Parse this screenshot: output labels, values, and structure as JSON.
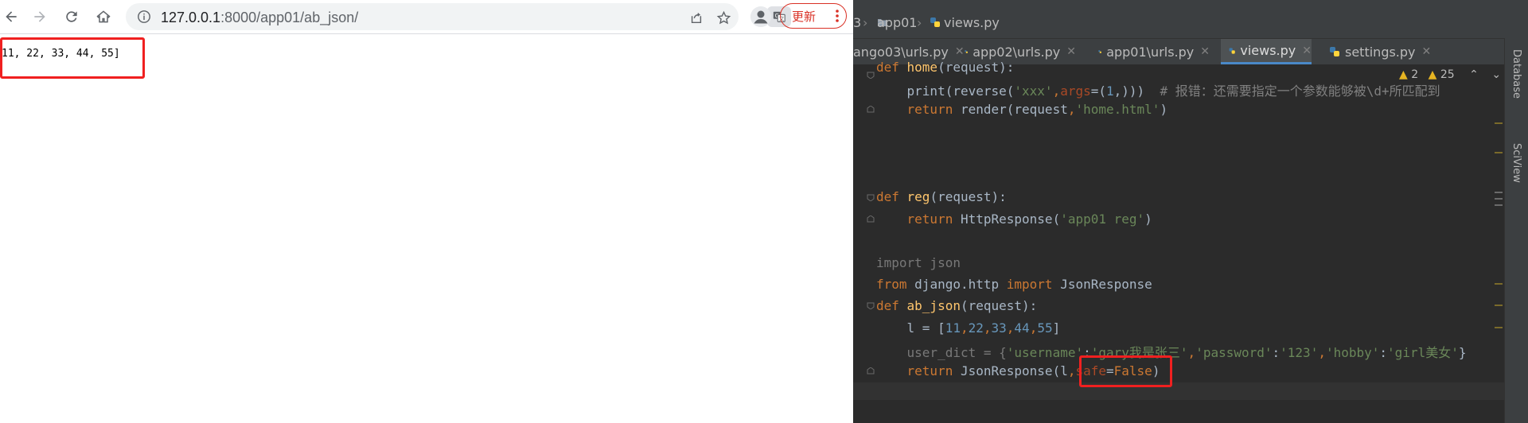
{
  "browser": {
    "url_host": "127.0.0.1",
    "url_path": ":8000/app01/ab_json/",
    "update_label": "更新",
    "page_text": "11, 22, 33, 44, 55]"
  },
  "ide": {
    "breadcrumb": [
      "3",
      "app01",
      "views.py"
    ],
    "tabs": [
      {
        "label": "ango03\\urls.py",
        "active": false
      },
      {
        "label": "app02\\urls.py",
        "active": false
      },
      {
        "label": "app01\\urls.py",
        "active": false
      },
      {
        "label": "views.py",
        "active": true
      },
      {
        "label": "settings.py",
        "active": false
      }
    ],
    "inspection": {
      "warnings": "2",
      "weak_warnings": "25"
    },
    "side_panels": [
      "Database",
      "SciView"
    ],
    "code": {
      "l1_kw": "def ",
      "l1_fn": "home",
      "l1_rest": "(request):",
      "l2_a": "    print(reverse(",
      "l2_s": "'xxx'",
      "l2_b": ",",
      "l2_p": "args",
      "l2_c": "=(",
      "l2_n": "1",
      "l2_d": ",)))  ",
      "l2_cmt": "# 报错：还需要指定一个参数能够被\\d+所匹配到",
      "l3_kw": "    return ",
      "l3_a": "render(request",
      "l3_b": ",",
      "l3_s": "'home.html'",
      "l3_c": ")",
      "l4_kw": "def ",
      "l4_fn": "reg",
      "l4_rest": "(request):",
      "l5_kw": "    return ",
      "l5_a": "HttpResponse(",
      "l5_s": "'app01 reg'",
      "l5_c": ")",
      "l6_dim": "import json",
      "l7_kw1": "from ",
      "l7_a": "django.http ",
      "l7_kw2": "import ",
      "l7_b": "JsonResponse",
      "l8_kw": "def ",
      "l8_fn": "ab_json",
      "l8_rest": "(request):",
      "l9_a": "    l = [",
      "l9_n1": "11",
      "l9_c1": ",",
      "l9_n2": "22",
      "l9_c2": ",",
      "l9_n3": "33",
      "l9_c3": ",",
      "l9_n4": "44",
      "l9_c4": ",",
      "l9_n5": "55",
      "l9_b": "]",
      "l10_a": "    user_dict = {",
      "l10_s1": "'username'",
      "l10_c1": ":",
      "l10_s2": "'gary我是张三'",
      "l10_c2": ",",
      "l10_s3": "'password'",
      "l10_c3": ":",
      "l10_s4": "'123'",
      "l10_c4": ",",
      "l10_s5": "'hobby'",
      "l10_c5": ":",
      "l10_s6": "'girl美女'",
      "l10_b": "}",
      "l11_kw": "    return ",
      "l11_a": "JsonResponse(l",
      "l11_c": ",",
      "l11_p": "safe",
      "l11_eq": "=",
      "l11_kw2": "False",
      "l11_b": ")"
    }
  }
}
